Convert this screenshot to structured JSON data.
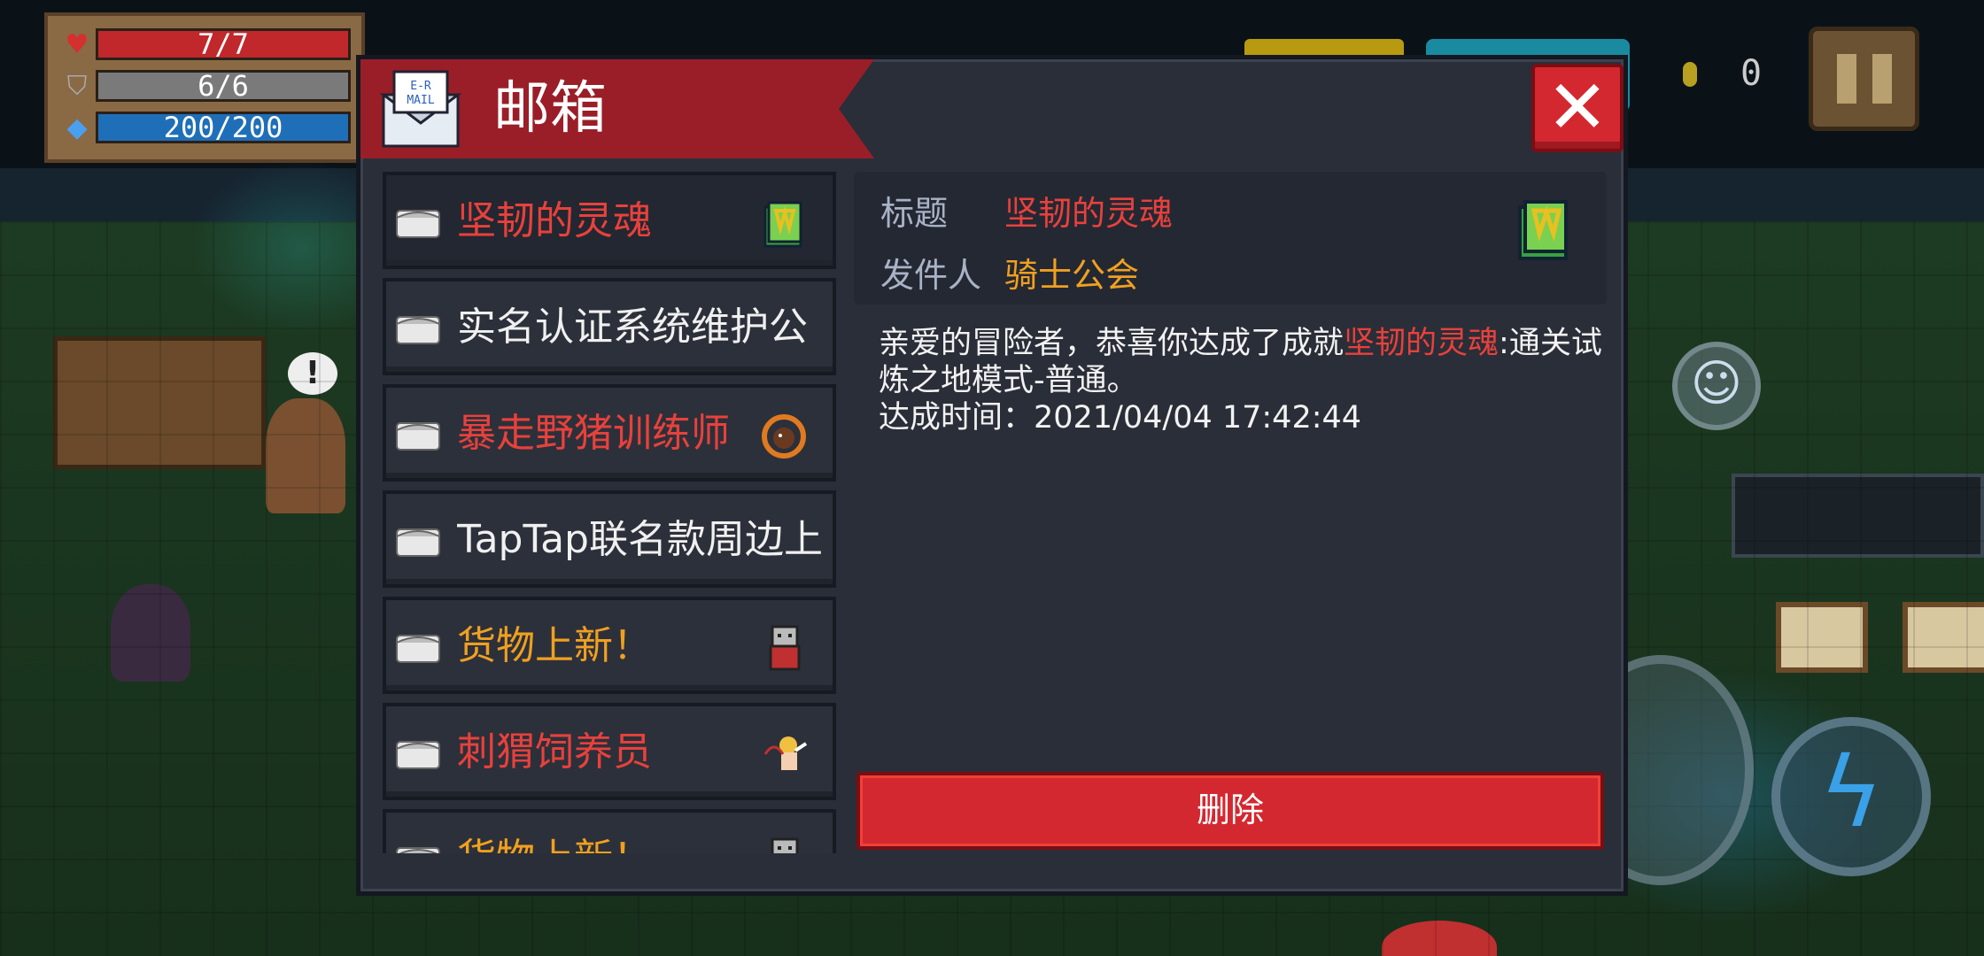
{
  "hud": {
    "hp": "7/7",
    "armor": "6/6",
    "energy": "200/200",
    "coins": "0"
  },
  "mailbox": {
    "title": "邮箱",
    "close_label": "✕",
    "items": [
      {
        "label": "坚韧的灵魂",
        "color": "#e8413c",
        "reward_icon": "green-book-icon"
      },
      {
        "label": "实名认证系统维护公",
        "color": "#f0f0f0",
        "reward_icon": ""
      },
      {
        "label": "暴走野猪训练师",
        "color": "#e8413c",
        "reward_icon": "boar-ring-icon"
      },
      {
        "label": "TapTap联名款周边上",
        "color": "#f0f0f0",
        "reward_icon": ""
      },
      {
        "label": "货物上新！",
        "color": "#f0a020",
        "reward_icon": "merchant-icon"
      },
      {
        "label": "刺猬饲养员",
        "color": "#e8413c",
        "reward_icon": "cupid-icon"
      },
      {
        "label": "货物上新！",
        "color": "#f0a020",
        "reward_icon": "merchant-icon"
      }
    ],
    "detail": {
      "subject_label": "标题",
      "subject": "坚韧的灵魂",
      "sender_label": "发件人",
      "sender": "骑士公会",
      "body_prefix": "亲爱的冒险者，恭喜你达成了成就",
      "body_highlight": "坚韧的灵魂",
      "body_suffix": ":通关试炼之地模式-普通。",
      "time_line": "达成时间：2021/04/04 17:42:44",
      "delete_label": "删除"
    }
  },
  "colors": {
    "accent_red": "#d42830",
    "header_red": "#9a1e28",
    "panel": "#2a2e38",
    "highlight_red": "#e8413c",
    "sender_orange": "#f0a020"
  }
}
